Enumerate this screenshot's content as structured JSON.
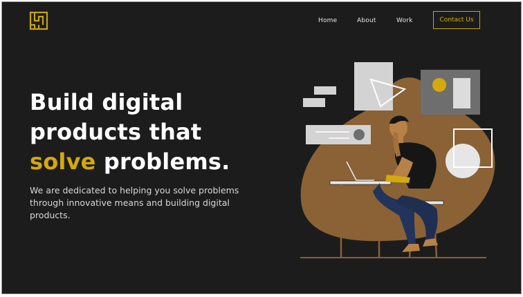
{
  "nav": {
    "items": [
      {
        "label": "Home"
      },
      {
        "label": "About"
      },
      {
        "label": "Work"
      }
    ],
    "cta_label": "Contact Us"
  },
  "hero": {
    "title_line1": "Build digital",
    "title_line2": "products that",
    "title_accent": "solve",
    "title_line3_rest": " problems.",
    "description": "We are dedicated to helping you solve problems through innovative means and building digital products."
  },
  "colors": {
    "background": "#1c1c1c",
    "accent": "#d4a90c",
    "blob": "#8a6236",
    "text": "#ffffff"
  },
  "icons": {
    "logo": "abstract-maze-logo-icon"
  }
}
